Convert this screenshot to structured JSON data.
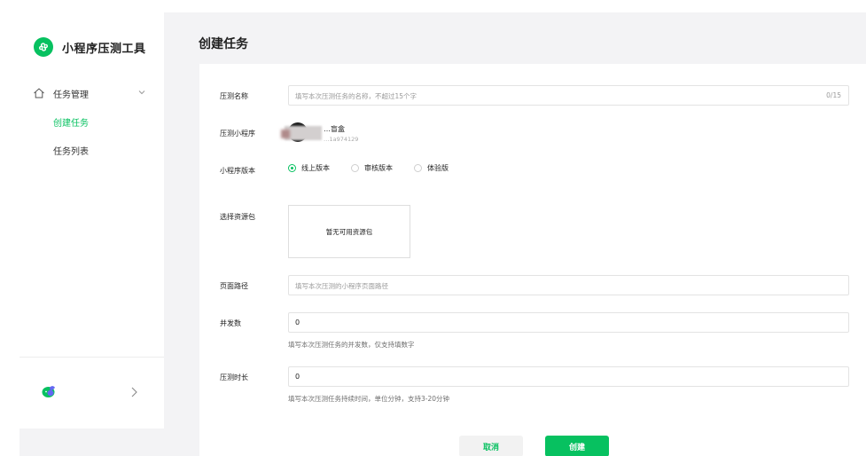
{
  "sidebar": {
    "brand": "小程序压测工具",
    "group_label": "任务管理",
    "items": [
      {
        "label": "创建任务",
        "active": true
      },
      {
        "label": "任务列表",
        "active": false
      }
    ]
  },
  "main": {
    "title": "创建任务",
    "form": {
      "name": {
        "label": "压测名称",
        "placeholder": "填写本次压测任务的名称，不超过15个字",
        "counter": "0/15"
      },
      "miniprogram": {
        "label": "压测小程序",
        "name": "…盲盒",
        "id": "…1a974129"
      },
      "version": {
        "label": "小程序版本",
        "options": [
          {
            "label": "线上版本",
            "checked": true
          },
          {
            "label": "审核版本",
            "checked": false
          },
          {
            "label": "体验版",
            "checked": false
          }
        ]
      },
      "package": {
        "label": "选择资源包",
        "empty_text": "暂无可用资源包"
      },
      "path": {
        "label": "页面路径",
        "placeholder": "填写本次压测的小程序页面路径"
      },
      "concurrency": {
        "label": "并发数",
        "value": "0",
        "hint": "填写本次压测任务的并发数，仅支持填数字"
      },
      "duration": {
        "label": "压测时长",
        "value": "0",
        "hint": "填写本次压测任务持续时间，单位分钟，支持3-20分钟"
      }
    },
    "buttons": {
      "cancel": "取消",
      "create": "创建"
    }
  },
  "colors": {
    "accent": "#07c160",
    "background": "#f3f3f5"
  }
}
